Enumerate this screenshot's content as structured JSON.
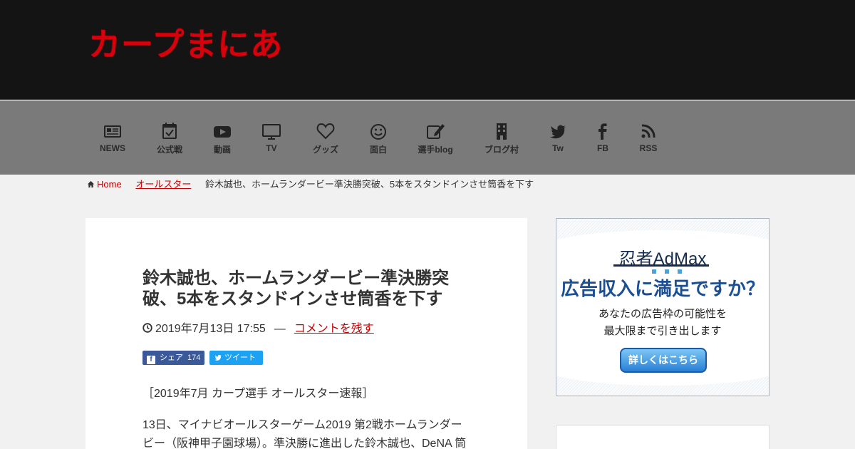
{
  "site": {
    "logo_text": "カープまにあ"
  },
  "nav": [
    {
      "label": "NEWS",
      "icon": "newspaper-icon"
    },
    {
      "label": "公式戦",
      "icon": "calendar-check-icon"
    },
    {
      "label": "動画",
      "icon": "youtube-icon"
    },
    {
      "label": "TV",
      "icon": "tv-icon"
    },
    {
      "label": "グッズ",
      "icon": "heart-icon"
    },
    {
      "label": "面白",
      "icon": "smile-icon"
    },
    {
      "label": "選手blog",
      "icon": "edit-icon"
    },
    {
      "label": "ブログ村",
      "icon": "building-icon"
    },
    {
      "label": "Tw",
      "icon": "twitter-icon"
    },
    {
      "label": "FB",
      "icon": "facebook-icon"
    },
    {
      "label": "RSS",
      "icon": "rss-icon"
    }
  ],
  "breadcrumb": {
    "home": "Home",
    "category": "オールスター",
    "current": "鈴木誠也、ホームランダービー準決勝突破、5本をスタンドインさせ筒香を下す"
  },
  "article": {
    "title": "鈴木誠也、ホームランダービー準決勝突破、5本をスタンドインさせ筒香を下す",
    "date": "2019年7月13日 17:55",
    "dash": "—",
    "comment_link": "コメントを残す",
    "share_label": "シェア",
    "share_count": "174",
    "tweet_label": "ツイート",
    "tagline": "［2019年7月 カープ選手 オールスター速報］",
    "body": "13日、マイナビオールスターゲーム2019 第2戦ホームランダービー（阪神甲子園球場）。準決勝に進出した鈴木誠也、DeNA 筒"
  },
  "ad": {
    "brand": "忍者AdMax",
    "headline": "広告収入に満足ですか？",
    "sub_line1": "あなたの広告枠の可能性を",
    "sub_line2": "最大限まで引き出します",
    "button": "詳しくはこちら",
    "colors": {
      "headline": "#1b4f94",
      "brand": "#152b4d",
      "button": "#2a7fd4"
    }
  },
  "colors": {
    "header_bg": "#141414",
    "nav_bg": "#7a7a7a",
    "accent": "#d8000c",
    "link": "#cc0000"
  }
}
